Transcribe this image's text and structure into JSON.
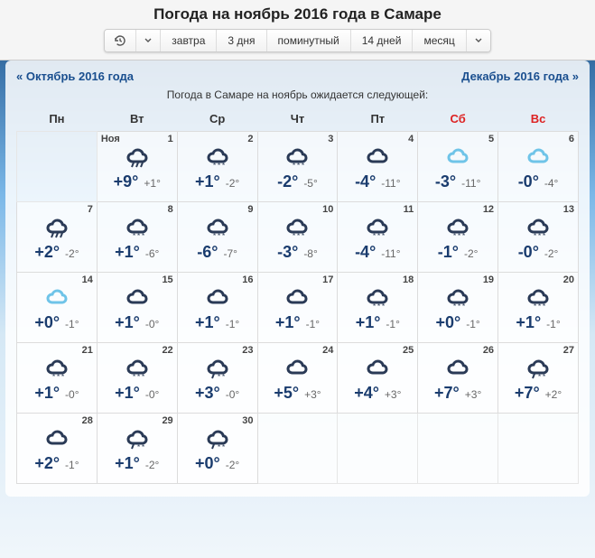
{
  "header": {
    "title": "Погода на ноябрь 2016 года в Самаре",
    "nav": [
      "завтра",
      "3 дня",
      "поминутный",
      "14 дней",
      "месяц"
    ]
  },
  "links": {
    "prev": "« Октябрь 2016 года",
    "next": "Декабрь 2016 года »"
  },
  "subtitle": "Погода в Самаре на ноябрь ожидается следующей:",
  "weekdays": [
    "Пн",
    "Вт",
    "Ср",
    "Чт",
    "Пт",
    "Сб",
    "Вс"
  ],
  "month_label": "Ноя",
  "start_offset": 1,
  "days": [
    {
      "n": 1,
      "hi": "+9°",
      "lo": "+1°",
      "icon": "rain"
    },
    {
      "n": 2,
      "hi": "+1°",
      "lo": "-2°",
      "icon": "snow"
    },
    {
      "n": 3,
      "hi": "-2°",
      "lo": "-5°",
      "icon": "snow"
    },
    {
      "n": 4,
      "hi": "-4°",
      "lo": "-11°",
      "icon": "cloud"
    },
    {
      "n": 5,
      "hi": "-3°",
      "lo": "-11°",
      "icon": "cloud-lt"
    },
    {
      "n": 6,
      "hi": "-0°",
      "lo": "-4°",
      "icon": "cloud-lt"
    },
    {
      "n": 7,
      "hi": "+2°",
      "lo": "-2°",
      "icon": "rain"
    },
    {
      "n": 8,
      "hi": "+1°",
      "lo": "-6°",
      "icon": "snow"
    },
    {
      "n": 9,
      "hi": "-6°",
      "lo": "-7°",
      "icon": "snow"
    },
    {
      "n": 10,
      "hi": "-3°",
      "lo": "-8°",
      "icon": "snow"
    },
    {
      "n": 11,
      "hi": "-4°",
      "lo": "-11°",
      "icon": "snow"
    },
    {
      "n": 12,
      "hi": "-1°",
      "lo": "-2°",
      "icon": "snow"
    },
    {
      "n": 13,
      "hi": "-0°",
      "lo": "-2°",
      "icon": "snow"
    },
    {
      "n": 14,
      "hi": "+0°",
      "lo": "-1°",
      "icon": "cloud-lt"
    },
    {
      "n": 15,
      "hi": "+1°",
      "lo": "-0°",
      "icon": "cloud"
    },
    {
      "n": 16,
      "hi": "+1°",
      "lo": "-1°",
      "icon": "cloud"
    },
    {
      "n": 17,
      "hi": "+1°",
      "lo": "-1°",
      "icon": "cloud"
    },
    {
      "n": 18,
      "hi": "+1°",
      "lo": "-1°",
      "icon": "snow"
    },
    {
      "n": 19,
      "hi": "+0°",
      "lo": "-1°",
      "icon": "snow"
    },
    {
      "n": 20,
      "hi": "+1°",
      "lo": "-1°",
      "icon": "snow"
    },
    {
      "n": 21,
      "hi": "+1°",
      "lo": "-0°",
      "icon": "snow"
    },
    {
      "n": 22,
      "hi": "+1°",
      "lo": "-0°",
      "icon": "snow"
    },
    {
      "n": 23,
      "hi": "+3°",
      "lo": "-0°",
      "icon": "sleet"
    },
    {
      "n": 24,
      "hi": "+5°",
      "lo": "+3°",
      "icon": "cloud"
    },
    {
      "n": 25,
      "hi": "+4°",
      "lo": "+3°",
      "icon": "cloud"
    },
    {
      "n": 26,
      "hi": "+7°",
      "lo": "+3°",
      "icon": "cloud"
    },
    {
      "n": 27,
      "hi": "+7°",
      "lo": "+2°",
      "icon": "sleet"
    },
    {
      "n": 28,
      "hi": "+2°",
      "lo": "-1°",
      "icon": "cloud"
    },
    {
      "n": 29,
      "hi": "+1°",
      "lo": "-2°",
      "icon": "sleet"
    },
    {
      "n": 30,
      "hi": "+0°",
      "lo": "-2°",
      "icon": "sleet"
    }
  ]
}
